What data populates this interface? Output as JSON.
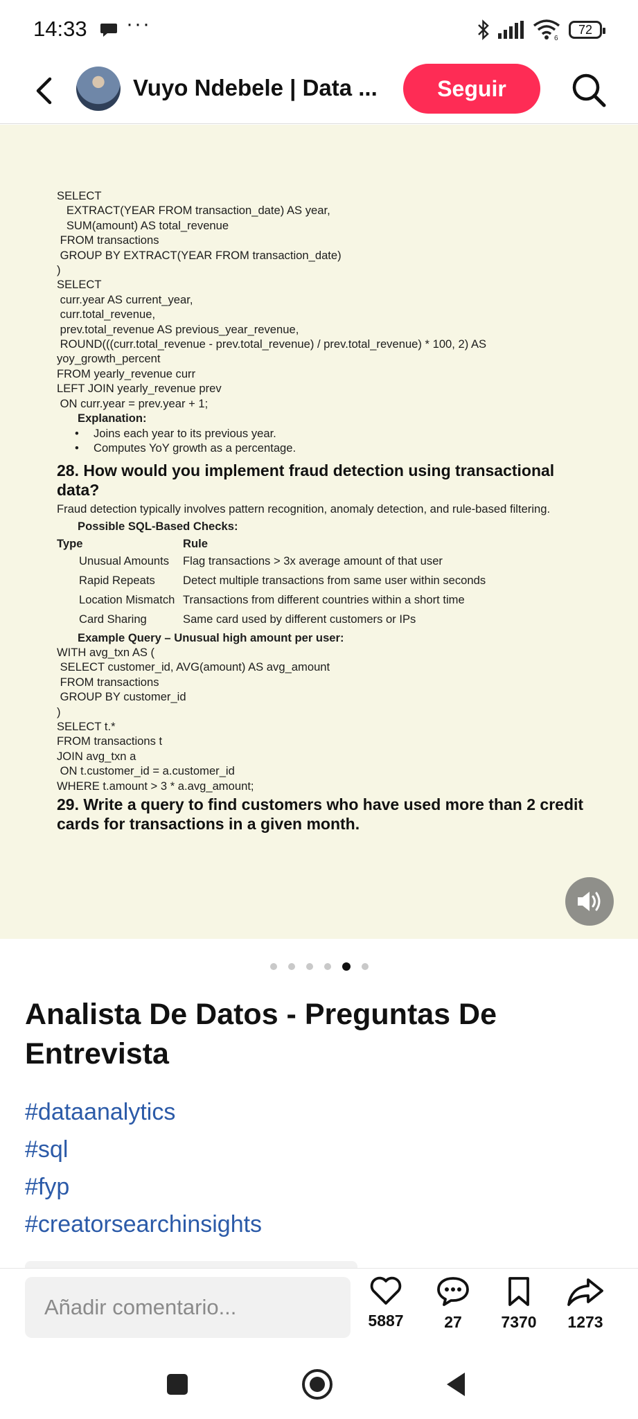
{
  "status_bar": {
    "time": "14:33",
    "more": "···",
    "battery": "72",
    "network": "6"
  },
  "header": {
    "creator_name": "Vuyo Ndebele | Data ...",
    "follow_label": "Seguir"
  },
  "post_image": {
    "code_block_1": "SELECT\n   EXTRACT(YEAR FROM transaction_date) AS year,\n   SUM(amount) AS total_revenue\n FROM transactions\n GROUP BY EXTRACT(YEAR FROM transaction_date)\n)\nSELECT\n curr.year AS current_year,\n curr.total_revenue,\n prev.total_revenue AS previous_year_revenue,\n ROUND(((curr.total_revenue - prev.total_revenue) / prev.total_revenue) * 100, 2) AS\nyoy_growth_percent\nFROM yearly_revenue curr\nLEFT JOIN yearly_revenue prev\n ON curr.year = prev.year + 1;",
    "explanation_label": "Explanation:",
    "explanation_items": [
      "Joins each year to its previous year.",
      "Computes YoY growth as a percentage."
    ],
    "q28_title": "28. How would you implement fraud detection using transactional data?",
    "q28_intro": "Fraud detection typically involves pattern recognition, anomaly detection, and rule-based filtering.",
    "checks_label": "Possible SQL-Based Checks:",
    "table_headers": [
      "Type",
      "Rule"
    ],
    "table_rows": [
      {
        "type": "Unusual Amounts",
        "rule": "Flag transactions > 3x average amount of that user"
      },
      {
        "type": "Rapid Repeats",
        "rule": "Detect multiple transactions from same user within seconds"
      },
      {
        "type": "Location Mismatch",
        "rule": "Transactions from different countries within a short time"
      },
      {
        "type": "Card Sharing",
        "rule": "Same card used by different customers or IPs"
      }
    ],
    "example_label": "Example Query – Unusual high amount per user:",
    "code_block_2": "WITH avg_txn AS (\n SELECT customer_id, AVG(amount) AS avg_amount\n FROM transactions\n GROUP BY customer_id\n)\nSELECT t.*\nFROM transactions t\nJOIN avg_txn a\n ON t.customer_id = a.customer_id\nWHERE t.amount > 3 * a.avg_amount;",
    "q29_title": "29. Write a query to find customers who have used more than 2 credit cards for transactions in a given month."
  },
  "pager": {
    "total": 6,
    "active_index": 4
  },
  "post": {
    "title": "Analista De Datos - Preguntas De Entrevista",
    "hashtags": [
      "#dataanalytics",
      "#sql",
      "#fyp",
      "#creatorsearchinsights"
    ]
  },
  "action_bar": {
    "comment_placeholder": "Añadir comentario...",
    "likes": "5887",
    "comments": "27",
    "saves": "7370",
    "shares": "1273"
  },
  "colors": {
    "accent": "#fe2c55",
    "hashtag": "#2b5aa8",
    "post_bg": "#f7f6e4"
  }
}
